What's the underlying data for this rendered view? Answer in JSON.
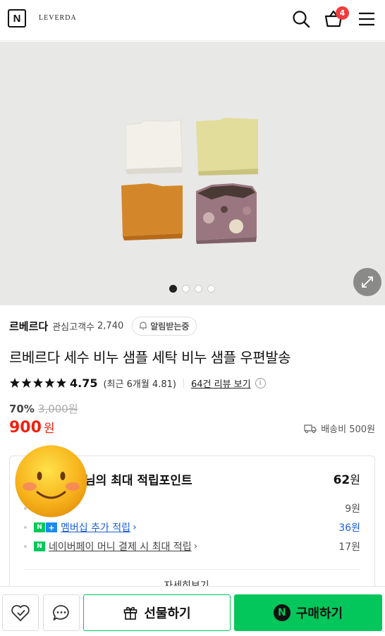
{
  "header": {
    "logo_letter": "N",
    "brand": "LEVERDA",
    "cart_count": "4",
    "icons": [
      "search-icon",
      "cart-icon",
      "menu-icon"
    ]
  },
  "gallery": {
    "dots_total": 4,
    "active_index": 0,
    "expand_icon": "expand-icon"
  },
  "store": {
    "name": "르베르다",
    "follower_label": "관심고객수",
    "follower_count": "2,740",
    "alarm_label": "알림받는중"
  },
  "product": {
    "title": "르베르다 세수 비누 샘플 세탁 비누 샘플 우편발송",
    "rating": "4.75",
    "recent_rating": "(최근 6개월 4.81)",
    "reviews_label": "64건 리뷰 보기",
    "discount": "70%",
    "original_price": "3,000원",
    "price": "900",
    "currency": "원",
    "shipping": "배송비 500원"
  },
  "points": {
    "title": "님의 최대 적립포인트",
    "total": "62",
    "total_unit": "원",
    "lines": [
      {
        "label": "",
        "value": "9원"
      },
      {
        "label": "멤버십 추가 적립",
        "value": "36원"
      },
      {
        "label": "네이버페이 머니 결제 시 최대 적립",
        "value": "17원"
      }
    ],
    "detail_label": "자세히보기"
  },
  "bottom": {
    "gift_label": "선물하기",
    "buy_label": "구매하기",
    "buy_logo": "N"
  },
  "colors": {
    "naver_green": "#03c75a",
    "price_red": "#f0200f",
    "badge_red": "#f03c3c",
    "link_blue": "#1a5fd6"
  }
}
